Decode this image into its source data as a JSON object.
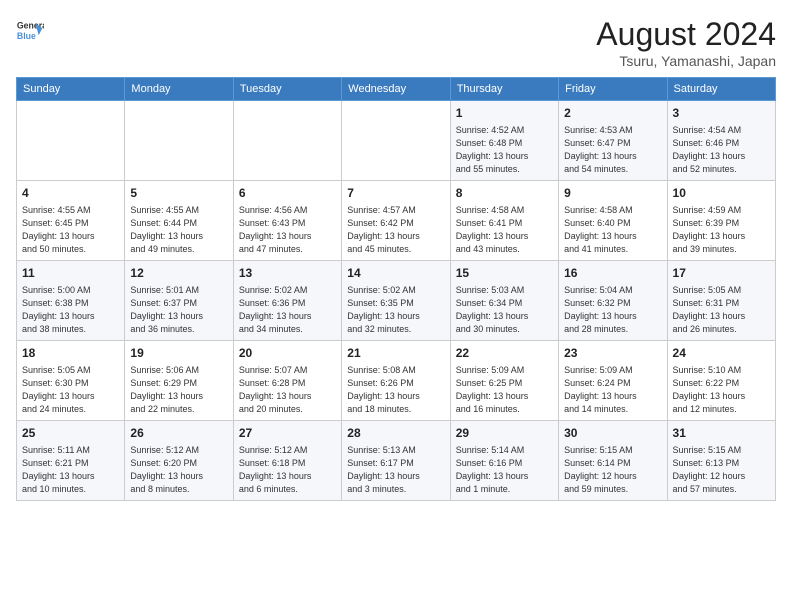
{
  "header": {
    "logo_line1": "General",
    "logo_line2": "Blue",
    "title": "August 2024",
    "subtitle": "Tsuru, Yamanashi, Japan"
  },
  "days_of_week": [
    "Sunday",
    "Monday",
    "Tuesday",
    "Wednesday",
    "Thursday",
    "Friday",
    "Saturday"
  ],
  "weeks": [
    [
      {
        "day": "",
        "info": ""
      },
      {
        "day": "",
        "info": ""
      },
      {
        "day": "",
        "info": ""
      },
      {
        "day": "",
        "info": ""
      },
      {
        "day": "1",
        "info": "Sunrise: 4:52 AM\nSunset: 6:48 PM\nDaylight: 13 hours\nand 55 minutes."
      },
      {
        "day": "2",
        "info": "Sunrise: 4:53 AM\nSunset: 6:47 PM\nDaylight: 13 hours\nand 54 minutes."
      },
      {
        "day": "3",
        "info": "Sunrise: 4:54 AM\nSunset: 6:46 PM\nDaylight: 13 hours\nand 52 minutes."
      }
    ],
    [
      {
        "day": "4",
        "info": "Sunrise: 4:55 AM\nSunset: 6:45 PM\nDaylight: 13 hours\nand 50 minutes."
      },
      {
        "day": "5",
        "info": "Sunrise: 4:55 AM\nSunset: 6:44 PM\nDaylight: 13 hours\nand 49 minutes."
      },
      {
        "day": "6",
        "info": "Sunrise: 4:56 AM\nSunset: 6:43 PM\nDaylight: 13 hours\nand 47 minutes."
      },
      {
        "day": "7",
        "info": "Sunrise: 4:57 AM\nSunset: 6:42 PM\nDaylight: 13 hours\nand 45 minutes."
      },
      {
        "day": "8",
        "info": "Sunrise: 4:58 AM\nSunset: 6:41 PM\nDaylight: 13 hours\nand 43 minutes."
      },
      {
        "day": "9",
        "info": "Sunrise: 4:58 AM\nSunset: 6:40 PM\nDaylight: 13 hours\nand 41 minutes."
      },
      {
        "day": "10",
        "info": "Sunrise: 4:59 AM\nSunset: 6:39 PM\nDaylight: 13 hours\nand 39 minutes."
      }
    ],
    [
      {
        "day": "11",
        "info": "Sunrise: 5:00 AM\nSunset: 6:38 PM\nDaylight: 13 hours\nand 38 minutes."
      },
      {
        "day": "12",
        "info": "Sunrise: 5:01 AM\nSunset: 6:37 PM\nDaylight: 13 hours\nand 36 minutes."
      },
      {
        "day": "13",
        "info": "Sunrise: 5:02 AM\nSunset: 6:36 PM\nDaylight: 13 hours\nand 34 minutes."
      },
      {
        "day": "14",
        "info": "Sunrise: 5:02 AM\nSunset: 6:35 PM\nDaylight: 13 hours\nand 32 minutes."
      },
      {
        "day": "15",
        "info": "Sunrise: 5:03 AM\nSunset: 6:34 PM\nDaylight: 13 hours\nand 30 minutes."
      },
      {
        "day": "16",
        "info": "Sunrise: 5:04 AM\nSunset: 6:32 PM\nDaylight: 13 hours\nand 28 minutes."
      },
      {
        "day": "17",
        "info": "Sunrise: 5:05 AM\nSunset: 6:31 PM\nDaylight: 13 hours\nand 26 minutes."
      }
    ],
    [
      {
        "day": "18",
        "info": "Sunrise: 5:05 AM\nSunset: 6:30 PM\nDaylight: 13 hours\nand 24 minutes."
      },
      {
        "day": "19",
        "info": "Sunrise: 5:06 AM\nSunset: 6:29 PM\nDaylight: 13 hours\nand 22 minutes."
      },
      {
        "day": "20",
        "info": "Sunrise: 5:07 AM\nSunset: 6:28 PM\nDaylight: 13 hours\nand 20 minutes."
      },
      {
        "day": "21",
        "info": "Sunrise: 5:08 AM\nSunset: 6:26 PM\nDaylight: 13 hours\nand 18 minutes."
      },
      {
        "day": "22",
        "info": "Sunrise: 5:09 AM\nSunset: 6:25 PM\nDaylight: 13 hours\nand 16 minutes."
      },
      {
        "day": "23",
        "info": "Sunrise: 5:09 AM\nSunset: 6:24 PM\nDaylight: 13 hours\nand 14 minutes."
      },
      {
        "day": "24",
        "info": "Sunrise: 5:10 AM\nSunset: 6:22 PM\nDaylight: 13 hours\nand 12 minutes."
      }
    ],
    [
      {
        "day": "25",
        "info": "Sunrise: 5:11 AM\nSunset: 6:21 PM\nDaylight: 13 hours\nand 10 minutes."
      },
      {
        "day": "26",
        "info": "Sunrise: 5:12 AM\nSunset: 6:20 PM\nDaylight: 13 hours\nand 8 minutes."
      },
      {
        "day": "27",
        "info": "Sunrise: 5:12 AM\nSunset: 6:18 PM\nDaylight: 13 hours\nand 6 minutes."
      },
      {
        "day": "28",
        "info": "Sunrise: 5:13 AM\nSunset: 6:17 PM\nDaylight: 13 hours\nand 3 minutes."
      },
      {
        "day": "29",
        "info": "Sunrise: 5:14 AM\nSunset: 6:16 PM\nDaylight: 13 hours\nand 1 minute."
      },
      {
        "day": "30",
        "info": "Sunrise: 5:15 AM\nSunset: 6:14 PM\nDaylight: 12 hours\nand 59 minutes."
      },
      {
        "day": "31",
        "info": "Sunrise: 5:15 AM\nSunset: 6:13 PM\nDaylight: 12 hours\nand 57 minutes."
      }
    ]
  ]
}
